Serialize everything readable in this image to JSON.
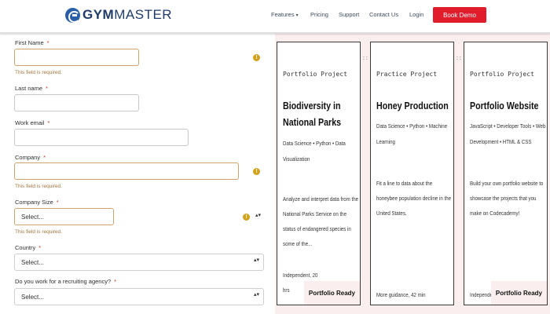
{
  "header": {
    "logo_bold": "GYM",
    "logo_regular": "MASTER",
    "nav": {
      "features": "Features",
      "pricing": "Pricing",
      "support": "Support",
      "contact": "Contact Us",
      "login": "Login"
    },
    "book_demo": "Book Demo"
  },
  "form": {
    "required_mark": "*",
    "error_text": "This field is required.",
    "first_name": {
      "label": "First Name",
      "value": ""
    },
    "last_name": {
      "label": "Last name",
      "value": ""
    },
    "work_email": {
      "label": "Work email",
      "value": ""
    },
    "company": {
      "label": "Company",
      "value": ""
    },
    "company_size": {
      "label": "Company Size",
      "selected": "Select..."
    },
    "country": {
      "label": "Country",
      "selected": "Select..."
    },
    "recruiting": {
      "label": "Do you work for a recruiting agency?",
      "selected": "Select..."
    }
  },
  "cards": [
    {
      "type": "Portfolio Project",
      "title": "Biodiversity in National Parks",
      "tags": "Data Science • Python • Data Visualization",
      "description": "Analyze and interpret data from the National Parks Service on the status of endangered species in some of the...",
      "meta": "Independent, 20 hrs",
      "badge": "Portfolio Ready"
    },
    {
      "type": "Practice Project",
      "title": "Honey Production",
      "tags": "Data Science • Python • Machine Learning",
      "description": "Fit a line to data about the honeybee population decline in the United States.",
      "meta": "More guidance, 42 min",
      "badge": ""
    },
    {
      "type": "Portfolio Project",
      "title": "Portfolio Website",
      "tags": "JavaScript • Developer Tools • Web Development • HTML & CSS",
      "description": "Build your own portfolio website to showcase the projects that you make on Codecademy!",
      "meta": "Independent, 5 hrs",
      "badge": "Portfolio Ready"
    }
  ],
  "icons": {
    "warning": "!",
    "select_arrow": "▴▾",
    "dropdown_caret": "▾"
  },
  "colors": {
    "brand": "#1f3b6b",
    "book_demo": "#e21d2b",
    "error_border": "#d0a46a",
    "warning_icon": "#d4a21a",
    "cards_bg": "#fbeeee"
  }
}
